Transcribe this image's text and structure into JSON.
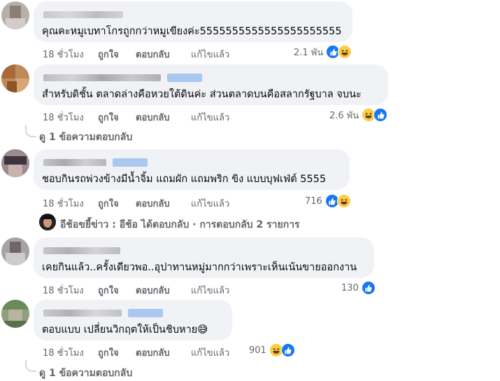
{
  "actions": {
    "time": "18 ชั่วโมง",
    "like": "ถูกใจ",
    "reply": "ตอบกลับ",
    "edited": "แก้ไขแล้ว"
  },
  "comments": [
    {
      "text": "คุณคะหมูเบทาโกรถูกกว่าหมูเขียงค่ะ5555555555555555555555",
      "reaction_count": "2.1 พัน",
      "reaction_icons": [
        "like-icon",
        "haha-icon"
      ]
    },
    {
      "text": "สำหรับดิชั้น ตลาดล่างคือหวยใต้ดินค่ะ ส่วนตลาดบนคือสลากรัฐบาล จบนะ",
      "reaction_count": "2.6 พัน",
      "reaction_icons": [
        "haha-icon",
        "like-icon"
      ]
    },
    {
      "text": "ชอบกินรถพ่วงข้างมีน้ำจิ้ม แถมผัก แถมพริก ขิง แบบบุฟเฟ่ต์ 5555",
      "reaction_count": "716",
      "reaction_icons": [
        "like-icon",
        "haha-icon"
      ]
    },
    {
      "text": "เคยกินแล้ว..ครั้งเดียวพอ..อุปาทานหมู่มากกว่าเพราะเห็นเน้นขายออกงาน",
      "reaction_count": "130",
      "reaction_icons": [
        "like-icon"
      ]
    },
    {
      "text": "ตอบแบบ เปลี่ยนวิกฤตให้เป็นชิบหาย😅",
      "reaction_count": "901",
      "reaction_icons": [
        "haha-icon",
        "like-icon"
      ]
    }
  ],
  "view_replies_1": "ดู 1 ข้อความตอบกลับ",
  "reply_summary": "อีช้อขยี้ข่าว : อีช้อ ได้ตอบกลับ · การตอบกลับ 2 รายการ",
  "view_replies_2": "ดู 1 ข้อความตอบกลับ",
  "colors": {
    "like": "#1877f2",
    "haha": "#fbcd4a",
    "bubble": "#f0f2f5",
    "meta": "#65676b"
  }
}
